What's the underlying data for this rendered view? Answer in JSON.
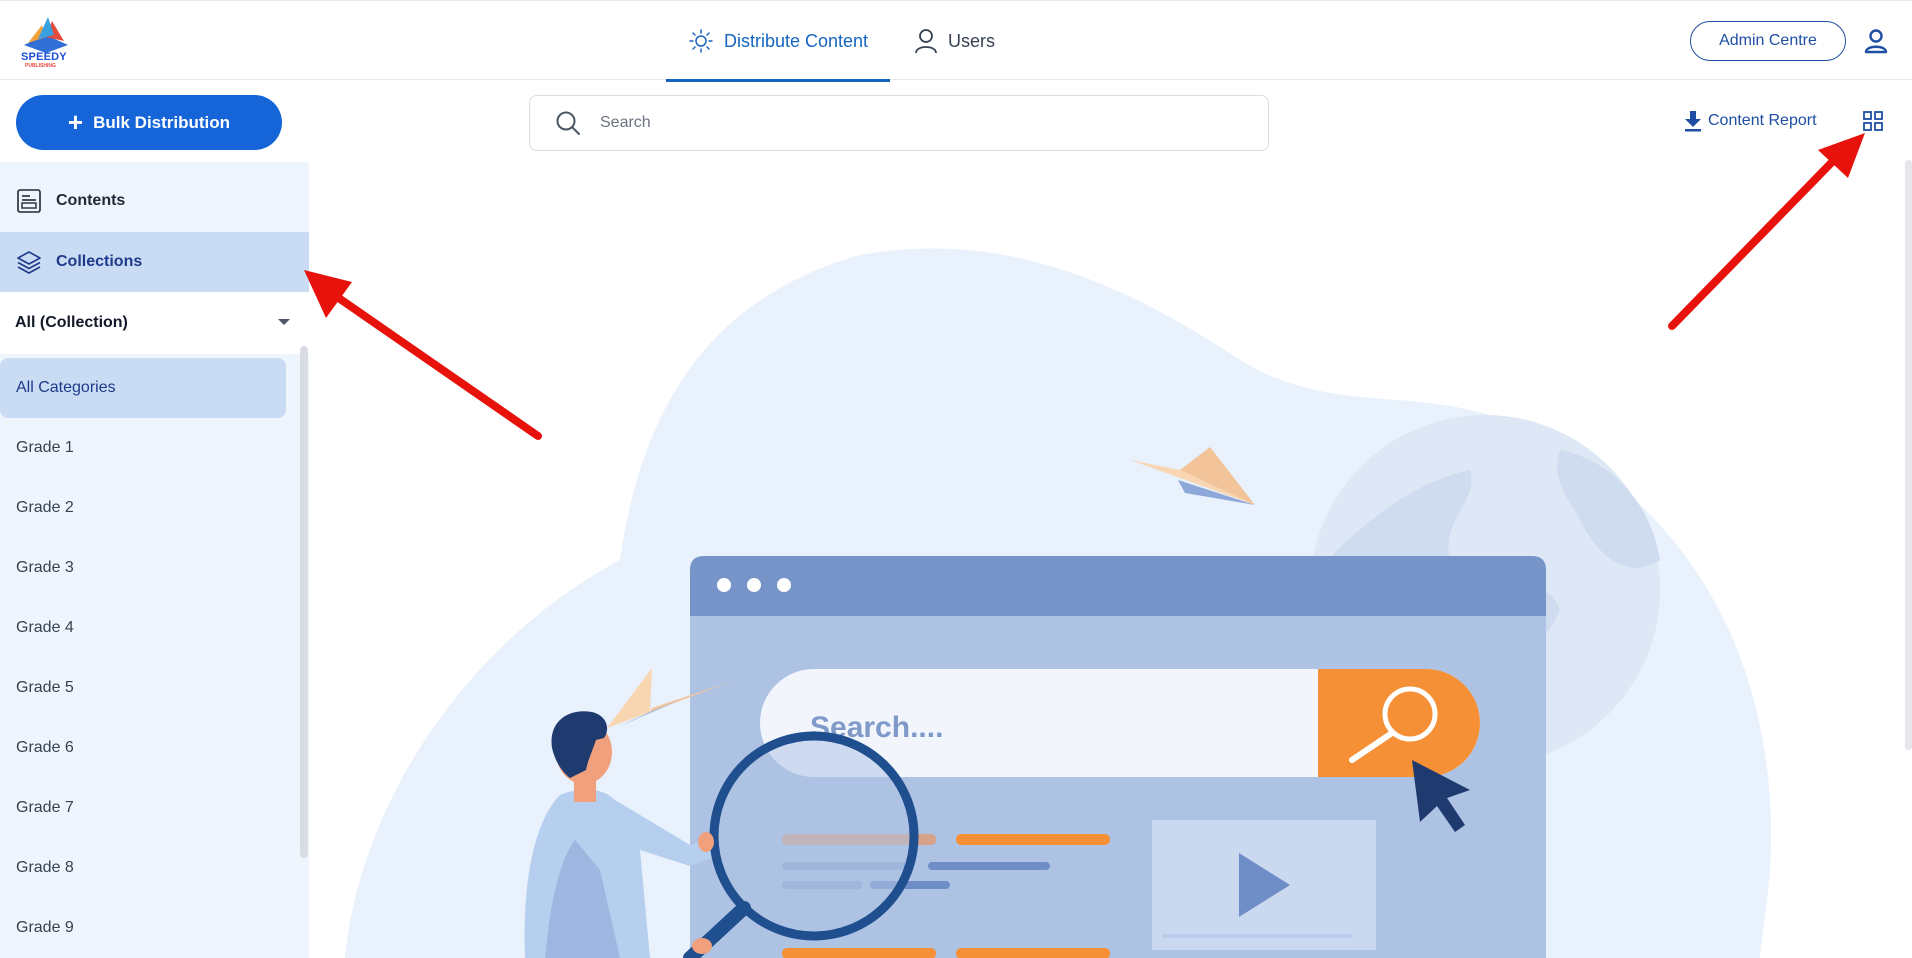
{
  "header": {
    "logo_text": "SPEEDY",
    "logo_subtext": "PUBLISHING",
    "tabs": [
      {
        "label": "Distribute Content",
        "active": true
      },
      {
        "label": "Users",
        "active": false
      }
    ],
    "admin_button": "Admin Centre",
    "user_icon": "user-icon"
  },
  "actions": {
    "bulk_button": "Bulk Distribution",
    "search_placeholder": "Search",
    "content_report": "Content Report",
    "view_toggle_icon": "grid-icon"
  },
  "sidebar": {
    "nav": [
      {
        "label": "Contents",
        "icon": "contents-icon",
        "active": false
      },
      {
        "label": "Collections",
        "icon": "layers-icon",
        "active": true
      }
    ],
    "collection_filter": "All (Collection)",
    "categories": [
      {
        "label": "All Categories",
        "active": true
      },
      {
        "label": "Grade 1"
      },
      {
        "label": "Grade 2"
      },
      {
        "label": "Grade 3"
      },
      {
        "label": "Grade 4"
      },
      {
        "label": "Grade 5"
      },
      {
        "label": "Grade 6"
      },
      {
        "label": "Grade 7"
      },
      {
        "label": "Grade 8"
      },
      {
        "label": "Grade 9"
      }
    ]
  },
  "illustration": {
    "search_text": "Search...."
  },
  "colors": {
    "primary": "#1565d8",
    "accent_orange": "#f59036",
    "sidebar_bg": "#eef5fd",
    "active_bg": "#c9dcf4",
    "annotation_arrow": "#e8120c"
  }
}
